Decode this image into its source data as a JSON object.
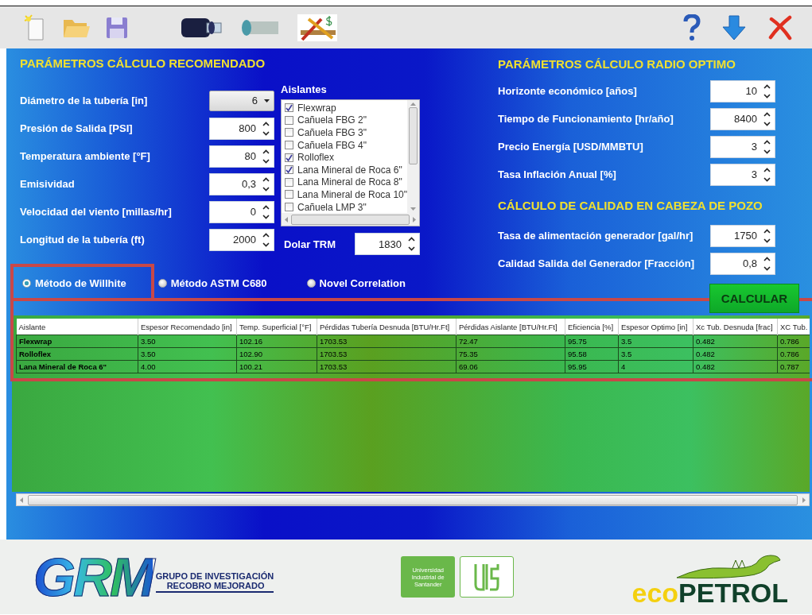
{
  "recommended": {
    "title": "PARÁMETROS CÁLCULO RECOMENDADO",
    "fields": [
      {
        "kind": "dropdown",
        "label": "Diámetro de la tubería [in]",
        "value": "6"
      },
      {
        "kind": "spin",
        "label": "Presión de Salida [PSI]",
        "value": "800"
      },
      {
        "kind": "spin",
        "label": "Temperatura ambiente [°F]",
        "value": "80"
      },
      {
        "kind": "spin",
        "label": "Emisividad",
        "value": "0,3"
      },
      {
        "kind": "spin",
        "label": "Velocidad del viento [millas/hr]",
        "value": "0"
      },
      {
        "kind": "spin",
        "label": "Longitud de la tubería (ft)",
        "value": "2000"
      }
    ]
  },
  "insulation": {
    "title": "Aislantes",
    "items": [
      {
        "label": "Flexwrap",
        "checked": true
      },
      {
        "label": "Cañuela FBG 2\"",
        "checked": false
      },
      {
        "label": "Cañuela FBG 3\"",
        "checked": false
      },
      {
        "label": "Cañuela FBG 4\"",
        "checked": false
      },
      {
        "label": "Rolloflex",
        "checked": true
      },
      {
        "label": "Lana Mineral de Roca 6\"",
        "checked": true
      },
      {
        "label": "Lana Mineral de Roca 8\"",
        "checked": false
      },
      {
        "label": "Lana Mineral de Roca 10\"",
        "checked": false
      },
      {
        "label": "Cañuela LMP 3\"",
        "checked": false
      }
    ]
  },
  "dollar": {
    "label": "Dolar TRM",
    "value": "1830"
  },
  "optimal": {
    "title": "PARÁMETROS CÁLCULO RADIO OPTIMO",
    "fields": [
      {
        "kind": "spin",
        "label": "Horizonte económico [años]",
        "value": "10"
      },
      {
        "kind": "spin",
        "label": "Tiempo de Funcionamiento [hr/año]",
        "value": "8400"
      },
      {
        "kind": "spin",
        "label": "Precio Energía [USD/MMBTU]",
        "value": "3"
      },
      {
        "kind": "spin",
        "label": "Tasa Inflación Anual [%]",
        "value": "3"
      }
    ]
  },
  "quality": {
    "title": "CÁLCULO DE CALIDAD EN CABEZA DE POZO",
    "fields": [
      {
        "kind": "spin",
        "label": "Tasa de alimentación generador [gal/hr]",
        "value": "1750"
      },
      {
        "kind": "spin",
        "label": "Calidad Salida del Generador [Fracción]",
        "value": "0,8"
      }
    ]
  },
  "methods": [
    {
      "label": "Método de Willhite",
      "selected": true
    },
    {
      "label": "Método ASTM C680",
      "selected": false
    },
    {
      "label": "Novel Correlation",
      "selected": false
    }
  ],
  "calculate_button": "CALCULAR",
  "table": {
    "columns": [
      "Aislante",
      "Espesor Recomendado [in]",
      "Temp. Superficial [°F]",
      "Pérdidas Tubería Desnuda [BTU/Hr.Ft]",
      "Pérdidas Aislante [BTU/Hr.Ft]",
      "Eficiencia [%]",
      "Espesor Optimo [in]",
      "Xc Tub. Desnuda [frac]",
      "XC Tub."
    ],
    "rows": [
      [
        "Flexwrap",
        "3.50",
        "102.16",
        "1703.53",
        "72.47",
        "95.75",
        "3.5",
        "0.482",
        "0.786"
      ],
      [
        "Rolloflex",
        "3.50",
        "102.90",
        "1703.53",
        "75.35",
        "95.58",
        "3.5",
        "0.482",
        "0.786"
      ],
      [
        "Lana Mineral de Roca 6\"",
        "4.00",
        "100.21",
        "1703.53",
        "69.06",
        "95.95",
        "4",
        "0.482",
        "0.787"
      ]
    ]
  },
  "footer": {
    "grm": {
      "letters": "GRM",
      "line1": "GRUPO DE INVESTIGACIÓN",
      "line2": "RECOBRO MEJORADO"
    },
    "uis": {
      "name": "Universidad Industrial de Santander"
    },
    "ecopetrol": {
      "parts": [
        "eco",
        "PETROL"
      ]
    }
  }
}
